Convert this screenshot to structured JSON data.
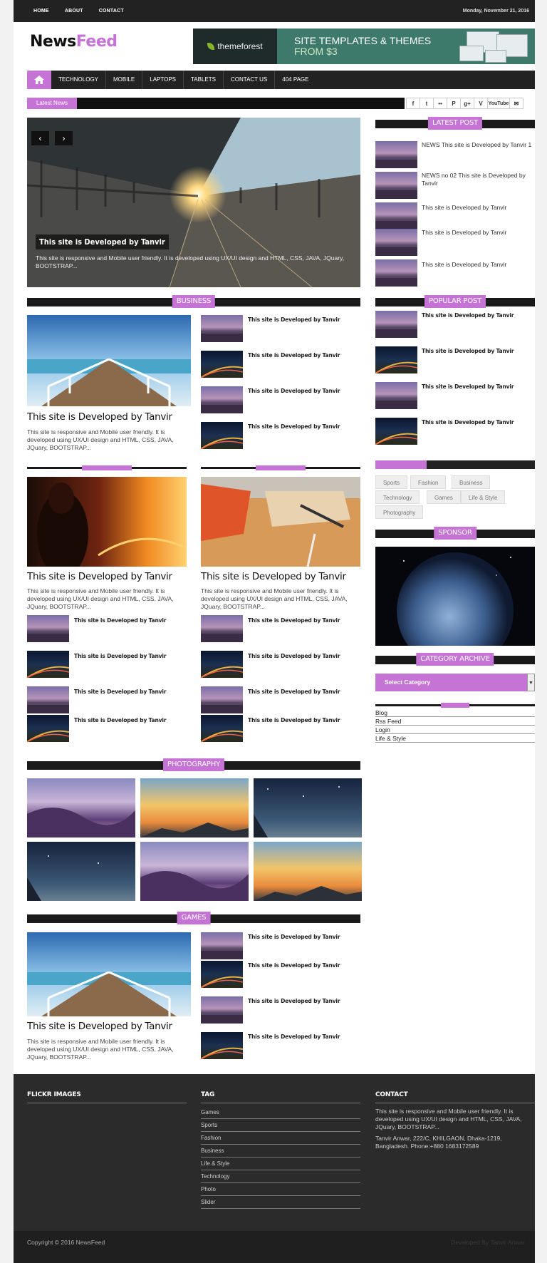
{
  "topbar": {
    "nav": [
      "HOME",
      "ABOUT",
      "CONTACT"
    ],
    "date": "Monday, November 21, 2016"
  },
  "logo": {
    "part1": "News",
    "part2": "Feed"
  },
  "banner": {
    "brand": "themeforest",
    "line1": "SITE TEMPLATES & THEMES",
    "line2": "FROM $3"
  },
  "mainnav": {
    "items": [
      "TECHNOLOGY",
      "MOBILE",
      "LAPTOPS",
      "TABLETS",
      "CONTACT US",
      "404 PAGE"
    ]
  },
  "ticker": {
    "label": "Latest News"
  },
  "social": {
    "items": [
      "f",
      "t",
      "••",
      "P",
      "g+",
      "V",
      "YouTube",
      "✉"
    ]
  },
  "slider": {
    "caption": "This site is Developed by Tanvir",
    "description": "This site is responsive and Mobile user friendly. It is developed using UX/UI design and HTML, CSS, JAVA, JQuary, BOOTSTRAP..."
  },
  "latest_post": {
    "title": "LATEST POST",
    "items": [
      "NEWS This site is Developed by Tanvir 1",
      "NEWS no 02 This site is Developed by Tanvir",
      "This site is Developed by Tanvir",
      "This site is Developed by Tanvir",
      "This site is Developed by Tanvir"
    ]
  },
  "business": {
    "title": "BUSINESS",
    "main_title": "This site is Developed by Tanvir",
    "main_desc": "This site is responsive and Mobile user friendly. It is developed using UX/UI design and HTML, CSS, JAVA, JQuary, BOOTSTRAP...",
    "items": [
      "This site is Developed by Tanvir",
      "This site is Developed by Tanvir",
      "This site is Developed by Tanvir",
      "This site is Developed by Tanvir"
    ]
  },
  "popular_post": {
    "title": "POPULAR POST",
    "items": [
      "This site is Developed by Tanvir",
      "This site is Developed by Tanvir",
      "This site is Developed by Tanvir",
      "This site is Developed by Tanvir"
    ]
  },
  "col_left": {
    "main_title": "This site is Developed by Tanvir",
    "main_desc": "This site is responsive and Mobile user friendly. It is developed using UX/UI design and HTML, CSS, JAVA, JQuary, BOOTSTRAP...",
    "items": [
      "This site is Developed by Tanvir",
      "This site is Developed by Tanvir",
      "This site is Developed by Tanvir",
      "This site is Developed by Tanvir"
    ]
  },
  "col_right": {
    "main_title": "This site is Developed by Tanvir",
    "main_desc": "This site is responsive and Mobile user friendly. It is developed using UX/UI design and HTML, CSS, JAVA, JQuary, BOOTSTRAP...",
    "items": [
      "This site is Developed by Tanvir",
      "This site is Developed by Tanvir",
      "This site is Developed by Tanvir",
      "This site is Developed by Tanvir"
    ]
  },
  "tags_widget": {
    "tags": [
      "Sports",
      "Fashion",
      "Business",
      "Technology",
      "Games",
      "Life & Style",
      "Photography"
    ]
  },
  "sponsor": {
    "title": "SPONSOR"
  },
  "category_archive": {
    "title": "CATEGORY ARCHIVE",
    "select_value": "Select Category"
  },
  "meta_links": [
    "Blog",
    "Rss Feed",
    "Login",
    "Life & Style"
  ],
  "photography": {
    "title": "PHOTOGRAPHY"
  },
  "games": {
    "title": "GAMES",
    "main_title": "This site is Developed by Tanvir",
    "main_desc": "This site is responsive and Mobile user friendly. It is developed using UX/UI design and HTML, CSS, JAVA, JQuary, BOOTSTRAP...",
    "items": [
      "This site is Developed by Tanvir",
      "This site is Developed by Tanvir",
      "This site is Developed by Tanvir",
      "This site is Developed by Tanvir"
    ]
  },
  "footer": {
    "flickr_title": "FLICKR IMAGES",
    "tag_title": "TAG",
    "tags": [
      "Games",
      "Sports",
      "Fashion",
      "Business",
      "Life & Style",
      "Technology",
      "Photo",
      "Slider"
    ],
    "contact_title": "CONTACT",
    "contact_desc": "This site is responsive and Mobile user friendly. It is developed using UX/UI design and HTML, CSS, JAVA, JQuary, BOOTSTRAP...",
    "contact_address": "Tanvir Anwar, 222/C, KHILGAON, Dhaka-1219, Bangladesh. Phone:+880 1683172589"
  },
  "copyright": {
    "left": "Copyright © 2016 NewsFeed",
    "right": "Developed By Tanvir Anwar"
  },
  "colors": {
    "accent": "#c574d6",
    "dark": "#222222"
  }
}
